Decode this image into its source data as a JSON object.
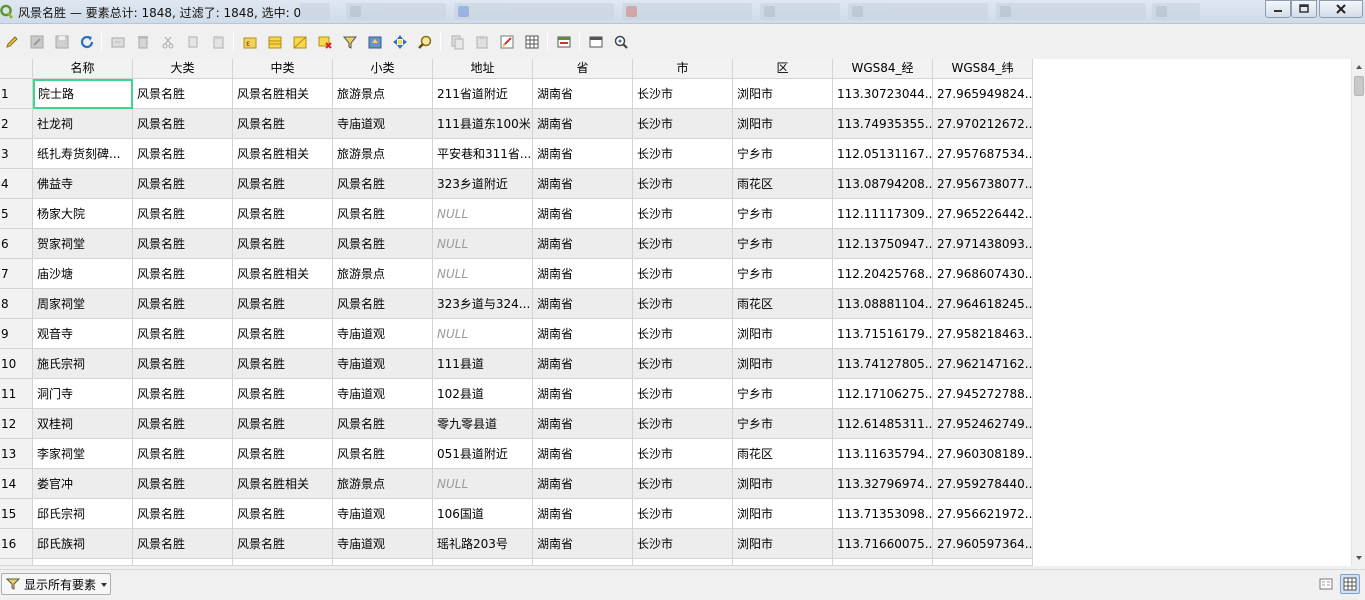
{
  "window": {
    "title": "风景名胜 — 要素总计: 1848, 过滤了: 1848, 选中: 0",
    "controls": [
      "minimize-icon",
      "maximize-icon",
      "close-icon"
    ]
  },
  "toolbar": {
    "icons": [
      "pencil-icon",
      "save-edits-icon",
      "save-icon",
      "reload-icon",
      "add-feature-icon",
      "delete-icon",
      "cut-icon",
      "copy-icon",
      "paste-icon",
      "select-expression-icon",
      "select-all-icon",
      "invert-selection-icon",
      "deselect-icon",
      "filter-icon",
      "move-selection-top-icon",
      "pan-map-icon",
      "zoom-map-icon",
      "copy-rows-icon",
      "paste-rows-icon",
      "field-calculator-icon",
      "conditional-format-icon",
      "dock-icon",
      "actions-icon",
      "identify-icon"
    ]
  },
  "table": {
    "columns": [
      "名称",
      "大类",
      "中类",
      "小类",
      "地址",
      "省",
      "市",
      "区",
      "WGS84_经",
      "WGS84_纬"
    ],
    "null_text": "NULL",
    "rows": [
      [
        "1",
        "院士路",
        "风景名胜",
        "风景名胜相关",
        "旅游景点",
        "211省道附近",
        "湖南省",
        "长沙市",
        "浏阳市",
        "113.30723044...",
        "27.965949824..."
      ],
      [
        "2",
        "社龙祠",
        "风景名胜",
        "风景名胜",
        "寺庙道观",
        "111县道东100米",
        "湖南省",
        "长沙市",
        "浏阳市",
        "113.74935355...",
        "27.970212672..."
      ],
      [
        "3",
        "纸扎寿货刻碑...",
        "风景名胜",
        "风景名胜相关",
        "旅游景点",
        "平安巷和311省...",
        "湖南省",
        "长沙市",
        "宁乡市",
        "112.05131167...",
        "27.957687534..."
      ],
      [
        "4",
        "佛益寺",
        "风景名胜",
        "风景名胜",
        "风景名胜",
        "323乡道附近",
        "湖南省",
        "长沙市",
        "雨花区",
        "113.08794208...",
        "27.956738077..."
      ],
      [
        "5",
        "杨家大院",
        "风景名胜",
        "风景名胜",
        "风景名胜",
        "NULL",
        "湖南省",
        "长沙市",
        "宁乡市",
        "112.11117309...",
        "27.965226442..."
      ],
      [
        "6",
        "贺家祠堂",
        "风景名胜",
        "风景名胜",
        "风景名胜",
        "NULL",
        "湖南省",
        "长沙市",
        "宁乡市",
        "112.13750947...",
        "27.971438093..."
      ],
      [
        "7",
        "庙沙塘",
        "风景名胜",
        "风景名胜相关",
        "旅游景点",
        "NULL",
        "湖南省",
        "长沙市",
        "宁乡市",
        "112.20425768...",
        "27.968607430..."
      ],
      [
        "8",
        "周家祠堂",
        "风景名胜",
        "风景名胜",
        "风景名胜",
        "323乡道与324...",
        "湖南省",
        "长沙市",
        "雨花区",
        "113.08881104...",
        "27.964618245..."
      ],
      [
        "9",
        "观音寺",
        "风景名胜",
        "风景名胜",
        "寺庙道观",
        "NULL",
        "湖南省",
        "长沙市",
        "浏阳市",
        "113.71516179...",
        "27.958218463..."
      ],
      [
        "10",
        "施氏宗祠",
        "风景名胜",
        "风景名胜",
        "寺庙道观",
        "111县道",
        "湖南省",
        "长沙市",
        "浏阳市",
        "113.74127805...",
        "27.962147162..."
      ],
      [
        "11",
        "洞门寺",
        "风景名胜",
        "风景名胜",
        "寺庙道观",
        "102县道",
        "湖南省",
        "长沙市",
        "宁乡市",
        "112.17106275...",
        "27.945272788..."
      ],
      [
        "12",
        "双桂祠",
        "风景名胜",
        "风景名胜",
        "风景名胜",
        "零九零县道",
        "湖南省",
        "长沙市",
        "宁乡市",
        "112.61485311...",
        "27.952462749..."
      ],
      [
        "13",
        "李家祠堂",
        "风景名胜",
        "风景名胜",
        "风景名胜",
        "051县道附近",
        "湖南省",
        "长沙市",
        "雨花区",
        "113.11635794...",
        "27.960308189..."
      ],
      [
        "14",
        "娄官冲",
        "风景名胜",
        "风景名胜相关",
        "旅游景点",
        "NULL",
        "湖南省",
        "长沙市",
        "浏阳市",
        "113.32796974...",
        "27.959278440..."
      ],
      [
        "15",
        "邱氏宗祠",
        "风景名胜",
        "风景名胜",
        "寺庙道观",
        "106国道",
        "湖南省",
        "长沙市",
        "浏阳市",
        "113.71353098...",
        "27.956621972..."
      ],
      [
        "16",
        "邱氏族祠",
        "风景名胜",
        "风景名胜",
        "寺庙道观",
        "瑶礼路203号",
        "湖南省",
        "长沙市",
        "浏阳市",
        "113.71660075...",
        "27.960597364..."
      ]
    ],
    "selected_row": 1,
    "selected_col": 1
  },
  "bottom": {
    "filter_label": "显示所有要素",
    "view_icons": [
      "form-view-icon",
      "table-view-icon"
    ]
  },
  "colors": {
    "selection_border": "#3cd68c",
    "alt_row": "#ededed",
    "null_text": "#9a9a9a"
  }
}
